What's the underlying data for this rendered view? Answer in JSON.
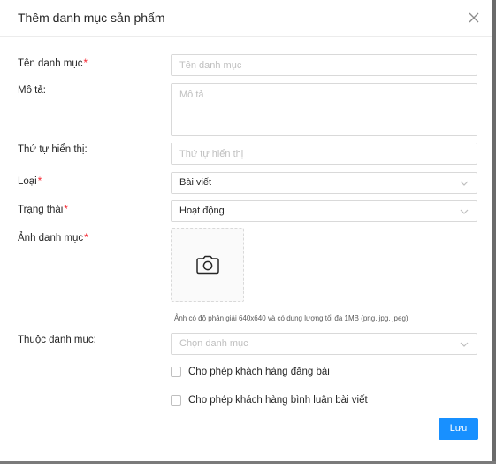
{
  "modal": {
    "title": "Thêm danh mục sản phẩm",
    "close_icon": "close-icon"
  },
  "form": {
    "name": {
      "label": "Tên danh mục",
      "required": "*",
      "placeholder": "Tên danh mục",
      "value": ""
    },
    "description": {
      "label": "Mô tả:",
      "placeholder": "Mô tả",
      "value": ""
    },
    "order": {
      "label": "Thứ tự hiển thị:",
      "placeholder": "Thứ tự hiển thị",
      "value": ""
    },
    "type": {
      "label": "Loại",
      "required": "*",
      "value": "Bài viết"
    },
    "status": {
      "label": "Trạng thái",
      "required": "*",
      "value": "Hoạt động"
    },
    "image": {
      "label": "Ảnh danh mục",
      "required": "*",
      "icon": "camera-icon",
      "hint": "Ảnh có độ phân giải 640x640 và có dung lượng tối đa 1MB (png, jpg, jpeg)"
    },
    "parent": {
      "label": "Thuộc danh mục:",
      "placeholder": "Chọn danh mục",
      "value": ""
    },
    "allow_post": {
      "label": "Cho phép khách hàng đăng bài",
      "checked": false
    },
    "allow_comment": {
      "label": "Cho phép khách hàng bình luận bài viết",
      "checked": false
    }
  },
  "footer": {
    "save_label": "Lưu"
  },
  "colors": {
    "primary": "#1890ff",
    "required": "#f5222d",
    "border": "#d9d9d9",
    "placeholder": "#bfbfbf"
  }
}
